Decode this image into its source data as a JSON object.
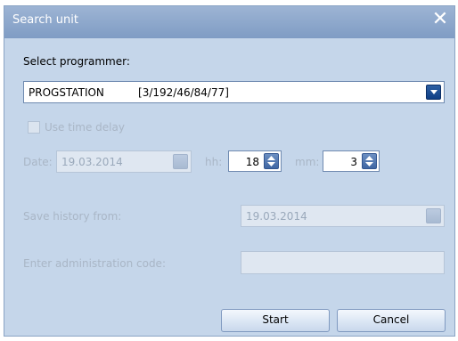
{
  "window": {
    "title": "Search unit",
    "close_icon": "close-icon"
  },
  "programmer": {
    "label": "Select programmer:",
    "selected": "PROGSTATION          [3/192/46/84/77]"
  },
  "time_delay": {
    "label": "Use time delay",
    "checked": false
  },
  "date": {
    "label": "Date:",
    "value": "19.03.2014"
  },
  "hh": {
    "label": "hh:",
    "value": "18"
  },
  "mm": {
    "label": "mm:",
    "value": "3"
  },
  "history": {
    "label": "Save history from:",
    "value": "19.03.2014"
  },
  "admin": {
    "label": "Enter administration code:",
    "value": ""
  },
  "buttons": {
    "start": "Start",
    "cancel": "Cancel"
  }
}
